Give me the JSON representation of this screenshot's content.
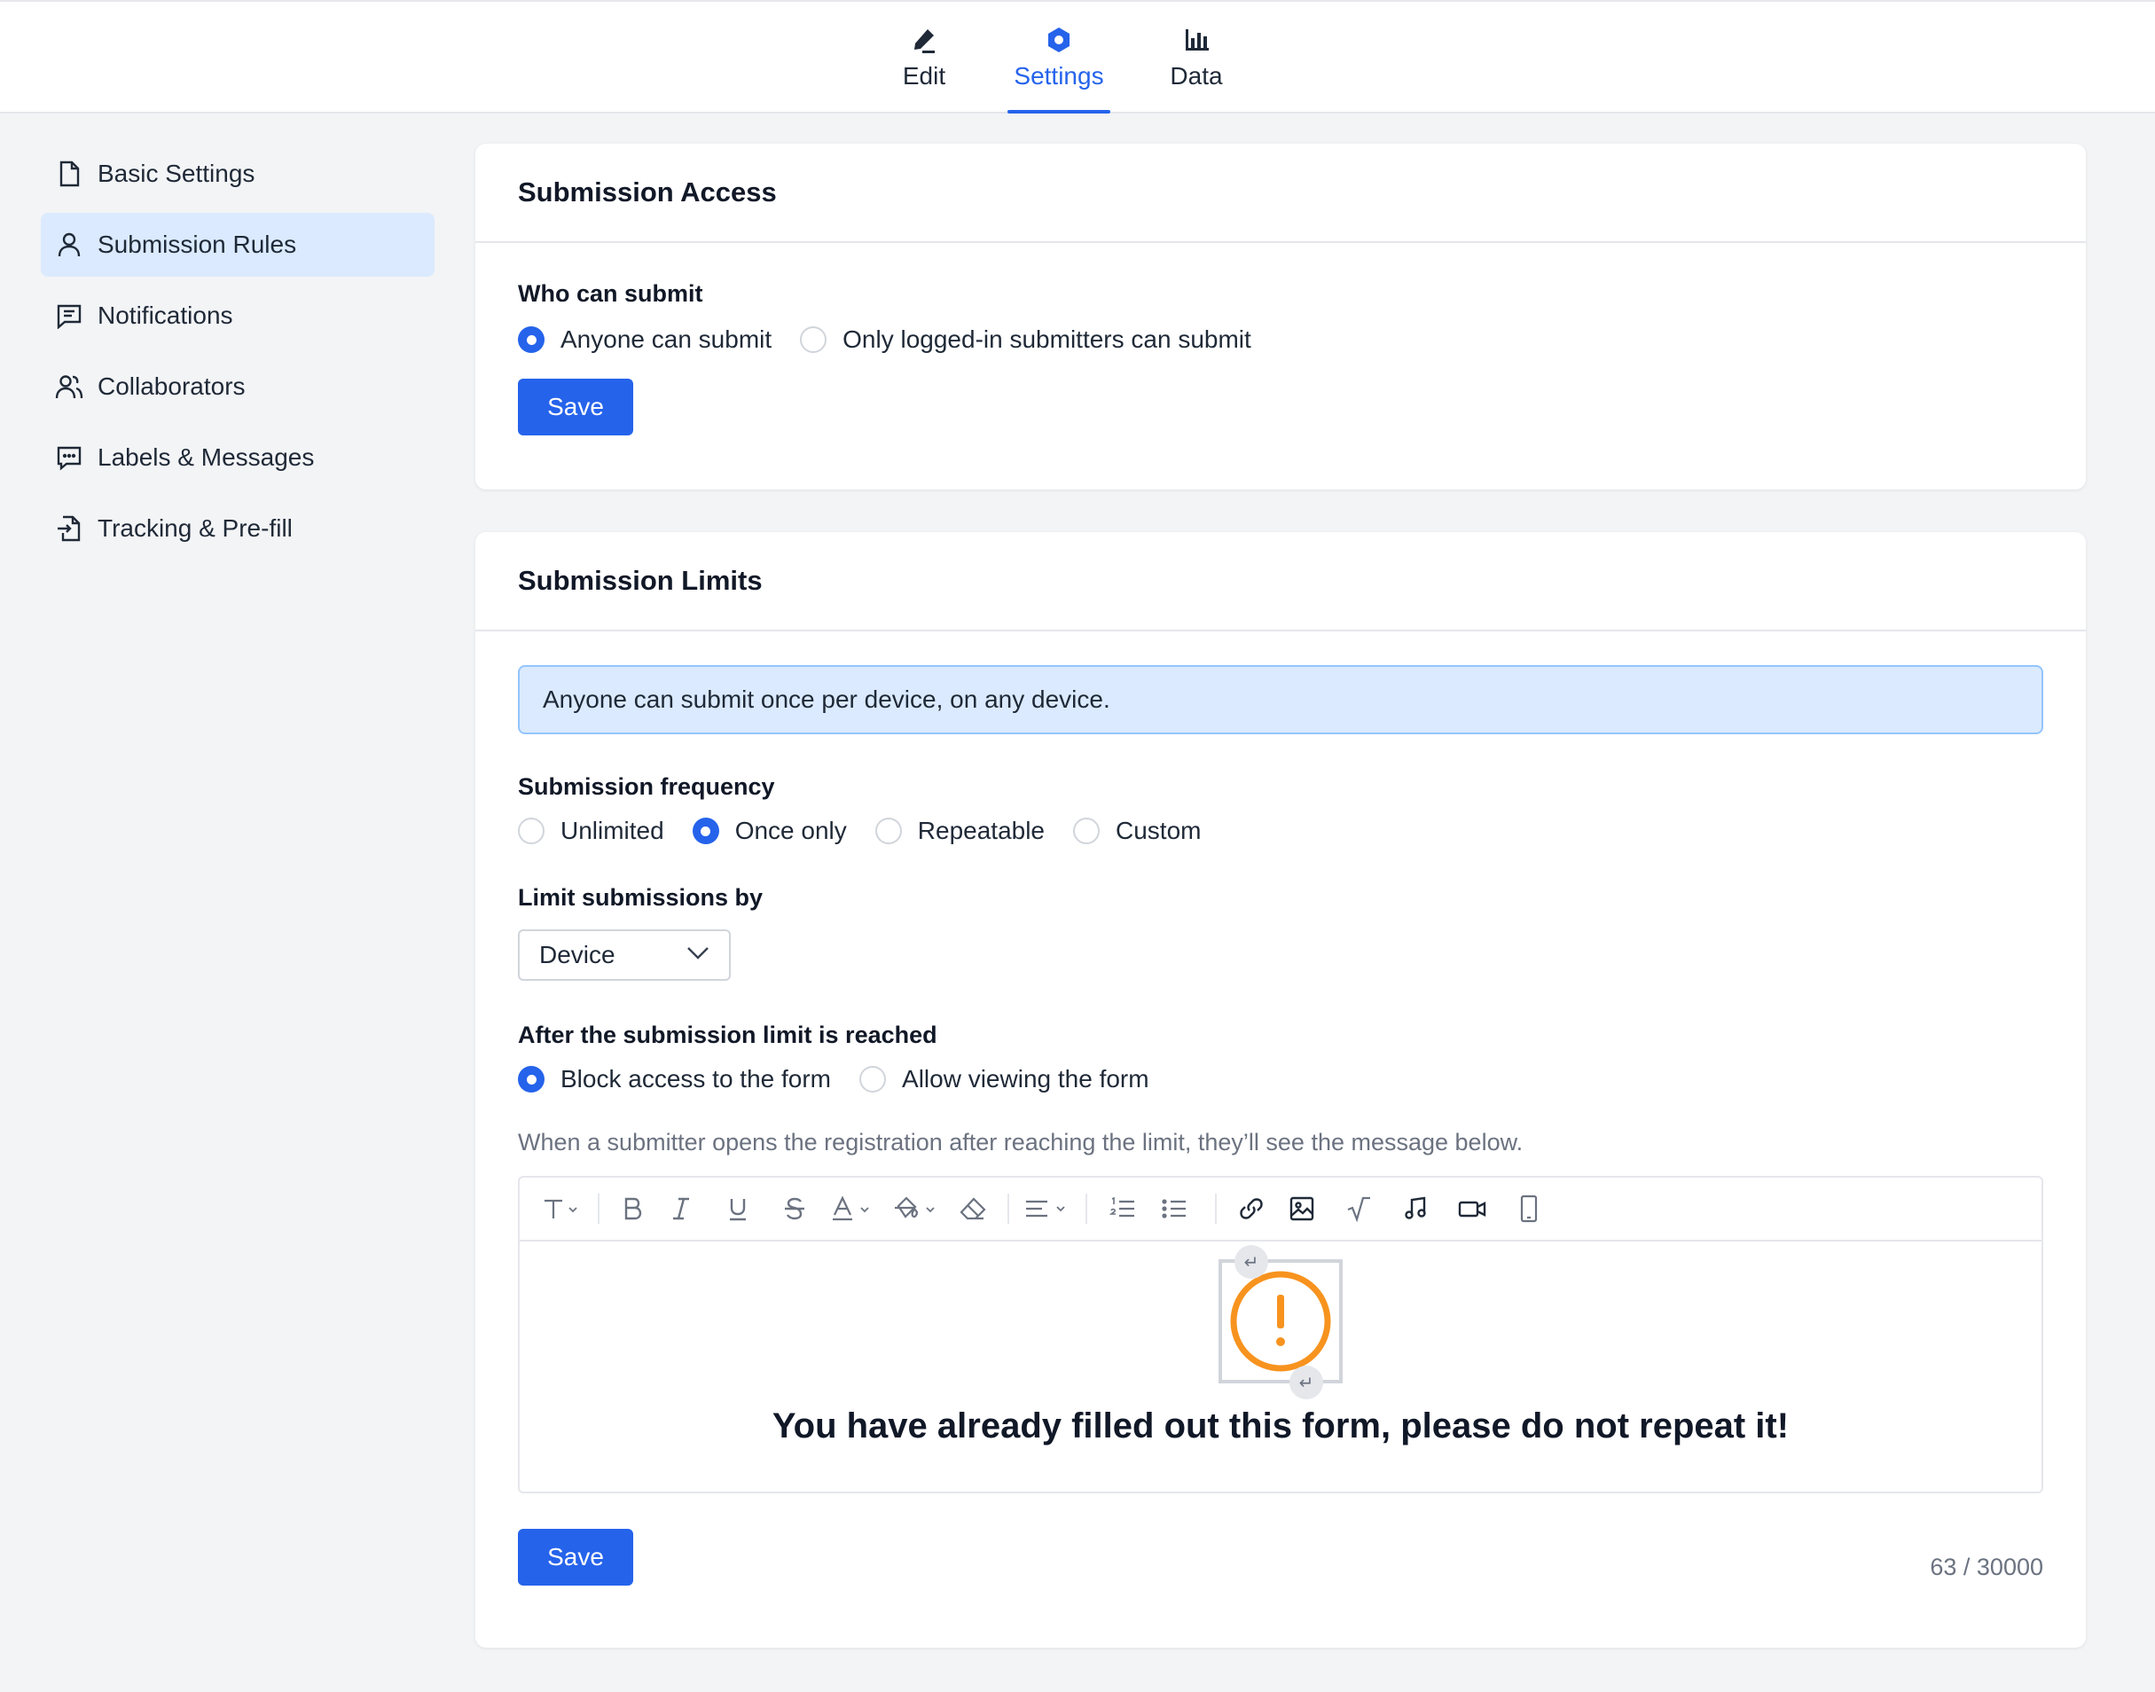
{
  "tabs": {
    "edit": "Edit",
    "settings": "Settings",
    "data": "Data"
  },
  "sidebar": {
    "items": [
      {
        "label": "Basic Settings",
        "icon": "file-icon"
      },
      {
        "label": "Submission Rules",
        "icon": "user-icon"
      },
      {
        "label": "Notifications",
        "icon": "notification-icon"
      },
      {
        "label": "Collaborators",
        "icon": "users-icon"
      },
      {
        "label": "Labels & Messages",
        "icon": "message-icon"
      },
      {
        "label": "Tracking & Pre-fill",
        "icon": "file-import-icon"
      }
    ],
    "active_index": 1
  },
  "access": {
    "title": "Submission Access",
    "who_label": "Who can submit",
    "options": [
      "Anyone can submit",
      "Only logged-in submitters can submit"
    ],
    "selected": 0,
    "save_label": "Save"
  },
  "limits": {
    "title": "Submission Limits",
    "info": "Anyone can submit once per device, on any device.",
    "frequency_label": "Submission frequency",
    "frequency_options": [
      "Unlimited",
      "Once only",
      "Repeatable",
      "Custom"
    ],
    "frequency_selected": 1,
    "limit_by_label": "Limit submissions by",
    "limit_by_value": "Device",
    "after_label": "After the submission limit is reached",
    "after_options": [
      "Block access to the form",
      "Allow viewing the form"
    ],
    "after_selected": 0,
    "hint": "When a submitter opens the registration after reaching the limit, they’ll see the message below.",
    "editor_message": "You have already filled out this form, please do not repeat it!",
    "char_count": "63 / 30000",
    "save_label": "Save"
  },
  "colors": {
    "accent": "#2563eb",
    "active_bg": "#dbeafe",
    "warning": "#f7931e"
  }
}
